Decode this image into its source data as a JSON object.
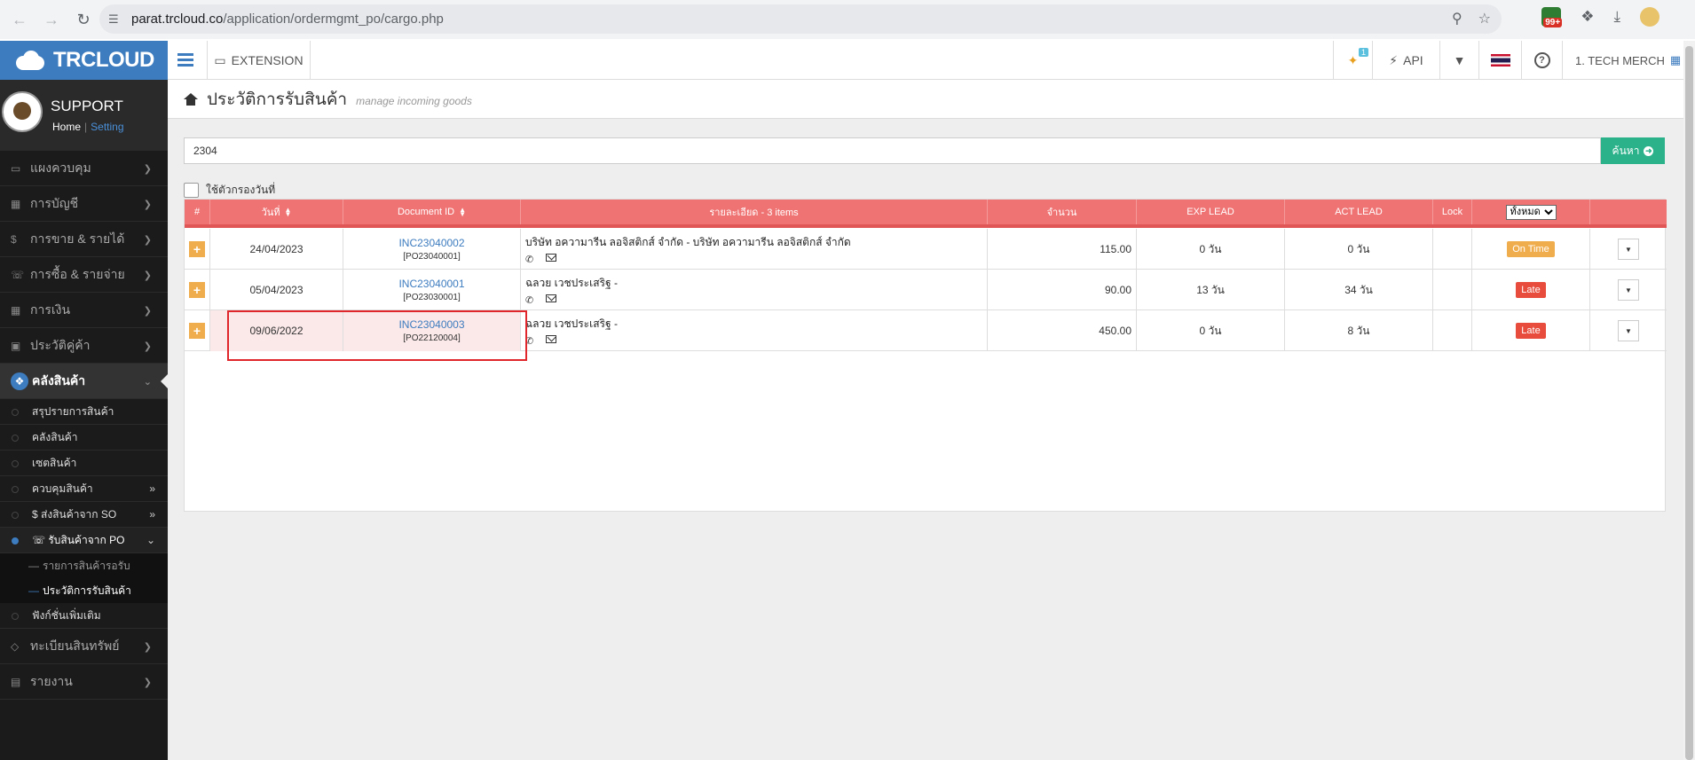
{
  "browser": {
    "url_host": "parat.trcloud.co",
    "url_path": "/application/ordermgmt_po/cargo.php",
    "ext_badge": "99+"
  },
  "sidebar": {
    "brand": "TRCLOUD",
    "user_name": "SUPPORT",
    "home_link": "Home",
    "separator": "|",
    "setting_link": "Setting",
    "items": [
      {
        "label": "แผงควบคุม",
        "icon": "monitor-icon"
      },
      {
        "label": "การบัญชี",
        "icon": "book-icon"
      },
      {
        "label": "การขาย & รายได้",
        "icon": "dollar-icon"
      },
      {
        "label": "การซื้อ & รายจ่าย",
        "icon": "cart-icon"
      },
      {
        "label": "การเงิน",
        "icon": "calendar-icon"
      },
      {
        "label": "ประวัติคู่ค้า",
        "icon": "contact-icon"
      }
    ],
    "active_item": "คลังสินค้า",
    "sub_items": [
      {
        "label": "สรุปรายการสินค้า"
      },
      {
        "label": "คลังสินค้า"
      },
      {
        "label": "เซตสินค้า"
      },
      {
        "label": "ควบคุมสินค้า"
      },
      {
        "label": "$ ส่งสินค้าจาก SO"
      },
      {
        "label": "รับสินค้าจาก PO"
      }
    ],
    "subsub_items": [
      {
        "label": "รายการสินค้ารอรับ"
      },
      {
        "label": "ประวัติการรับสินค้า"
      }
    ],
    "extra_sub": "ฟังก์ชั่นเพิ่มเติม",
    "bottom_items": [
      {
        "label": "ทะเบียนสินทรัพย์",
        "icon": "diamond-icon"
      },
      {
        "label": "รายงาน",
        "icon": "report-icon"
      }
    ]
  },
  "topbar": {
    "extension_label": "EXTENSION",
    "notif_count": "1",
    "api_label": "API",
    "company": "1. TECH MERCH"
  },
  "page": {
    "title": "ประวัติการรับสินค้า",
    "subtitle": "manage incoming goods"
  },
  "search": {
    "value": "2304",
    "button_label": "ค้นหา"
  },
  "date_filter_label": "ใช้ตัวกรองวันที่",
  "table": {
    "headers": {
      "num": "#",
      "date": "วันที่",
      "docid": "Document ID",
      "detail": "รายละเอียด - 3 items",
      "amount": "จำนวน",
      "exp_lead": "EXP LEAD",
      "act_lead": "ACT LEAD",
      "lock": "Lock",
      "filter_selected": "ทั้งหมด"
    },
    "rows": [
      {
        "date": "24/04/2023",
        "doc": "INC23040002",
        "po": "[PO23040001]",
        "detail": "บริษัท อความารีน ลอจิสติกส์ จำกัด - บริษัท อความารีน ลอจิสติกส์ จำกัด",
        "amount": "115.00",
        "exp": "0 วัน",
        "act": "0 วัน",
        "status": "On Time"
      },
      {
        "date": "05/04/2023",
        "doc": "INC23040001",
        "po": "[PO23030001]",
        "detail": "ฉลวย เวชประเสริฐ -",
        "amount": "90.00",
        "exp": "13 วัน",
        "act": "34 วัน",
        "status": "Late"
      },
      {
        "date": "09/06/2022",
        "doc": "INC23040003",
        "po": "[PO22120004]",
        "detail": "ฉลวย เวชประเสริฐ -",
        "amount": "450.00",
        "exp": "0 วัน",
        "act": "8 วัน",
        "status": "Late"
      }
    ]
  },
  "colors": {
    "brand": "#3d7cbf",
    "header": "#f07373",
    "search_btn": "#2bb28a",
    "ontime": "#f0ad4e",
    "late": "#e74c3c"
  }
}
